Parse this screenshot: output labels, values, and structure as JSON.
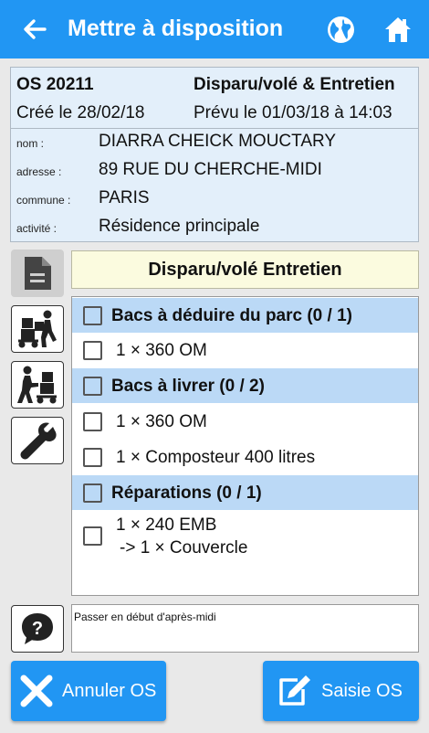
{
  "header": {
    "title": "Mettre à disposition",
    "back_icon": "arrow-left-icon",
    "globe_icon": "globe-icon",
    "home_icon": "home-icon"
  },
  "order": {
    "os_number": "OS  20211",
    "type": "Disparu/volé & Entretien",
    "created": "Créé le 28/02/18",
    "planned": "Prévu le 01/03/18 à 14:03",
    "fields": [
      {
        "label": "nom :",
        "value": "DIARRA CHEICK MOUCTARY"
      },
      {
        "label": "adresse :",
        "value": "89 RUE DU CHERCHE-MIDI"
      },
      {
        "label": "commune :",
        "value": "PARIS"
      },
      {
        "label": "activité :",
        "value": "Résidence principale"
      }
    ]
  },
  "side_buttons": [
    "document-icon",
    "cart-worker-icon",
    "delivery-worker-icon",
    "wrench-icon"
  ],
  "section_title": "Disparu/volé  Entretien",
  "checklist": {
    "groups": [
      {
        "label": "Bacs à déduire du parc (0 / 1)",
        "items": [
          "1 × 360 OM"
        ]
      },
      {
        "label": "Bacs à livrer (0 / 2)",
        "items": [
          "1 × 360 OM",
          "1 × Composteur 400 litres"
        ]
      },
      {
        "label": "Réparations (0 / 1)",
        "items": [
          {
            "line1": "1 × 240 EMB",
            "line2": "-> 1 × Couvercle"
          }
        ]
      }
    ]
  },
  "note": {
    "icon": "question-bubble-icon",
    "text": "Passer en début d'après-midi"
  },
  "actions": {
    "cancel_label": "Annuler OS",
    "cancel_icon": "close-x-icon",
    "entry_label": "Saisie OS",
    "entry_icon": "edit-pen-icon"
  },
  "colors": {
    "primary": "#2196f3",
    "info_bg": "#e3effa",
    "group_bg": "#bbd9f6",
    "heading_bg": "#fbfbdf"
  }
}
